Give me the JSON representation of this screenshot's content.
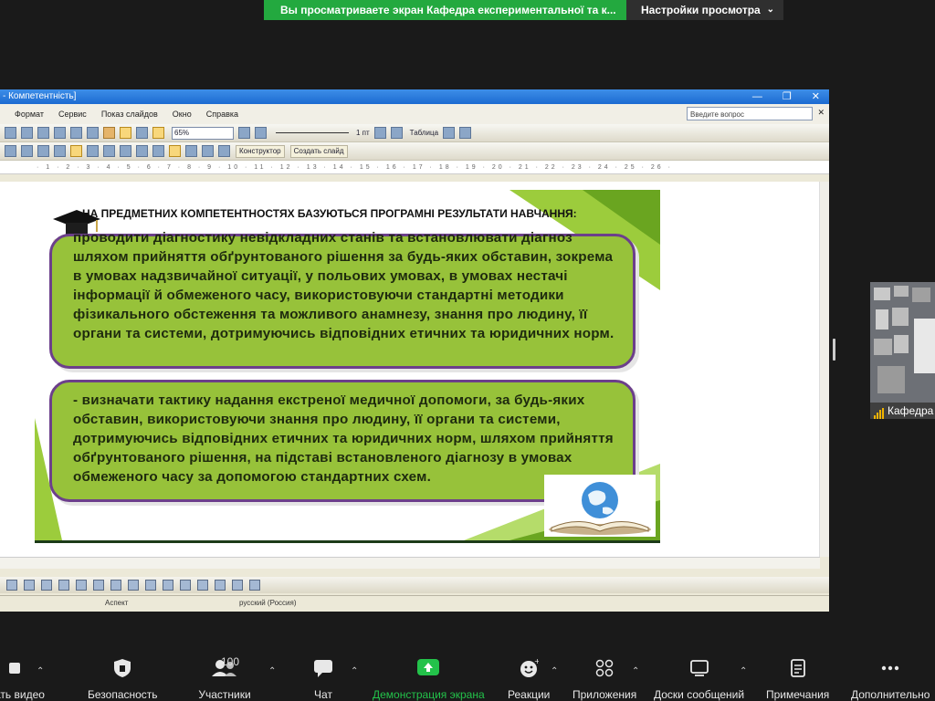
{
  "banner": {
    "viewing_text": "Вы просматриваете экран Кафедра експериментальної та к...",
    "settings_label": "Настройки просмотра"
  },
  "app": {
    "title": "- Компетентність]",
    "menu": [
      "Формат",
      "Сервис",
      "Показ слайдов",
      "Окно",
      "Справка"
    ],
    "ask_placeholder": "Введите вопрос",
    "zoom": "65%",
    "line_weight": "1 пт",
    "table_label": "Таблица",
    "constructor_label": "Конструктор",
    "create_slide_label": "Создать слайд",
    "status_design": "Аспект",
    "status_language": "русский (Россия)"
  },
  "slide": {
    "heading": "НА ПРЕДМЕТНИХ КОМПЕТЕНТНОСТЯХ БАЗУЮТЬСЯ ПРОГРАМНІ РЕЗУЛЬТАТИ НАВЧАННЯ:",
    "box1_text": "проводити діагностику невідкладних станів та встановлювати діагноз шляхом прийняття обґрунтованого рішення за будь-яких обставин, зокрема в умовах надзвичайної ситуації, у польових умовах, в умовах нестачі інформації й обмеженого часу, використовуючи стандартні методики фізикального обстеження та можливого анамнезу, знання про людину, її органи та системи, дотримуючись відповідних етичних та юридичних норм.",
    "box2_text": "- визначати тактику надання екстреної медичної допомоги, за будь-яких обставин, використовуючи знання про людину, її органи та системи, дотримуючись відповідних етичних та юридичних норм, шляхом прийняття обґрунтованого рішення, на підставі встановленого діагнозу в умовах обмеженого часу за допомогою стандартних схем."
  },
  "participant": {
    "name": "Кафедра експ"
  },
  "toolbar": {
    "video_label": "ать видео",
    "security_label": "Безопасность",
    "participants_label": "Участники",
    "participants_count": "100",
    "chat_label": "Чат",
    "share_label": "Демонстрация экрана",
    "reactions_label": "Реакции",
    "apps_label": "Приложения",
    "whiteboards_label": "Доски сообщений",
    "notes_label": "Примечания",
    "more_label": "Дополнительно"
  },
  "colors": {
    "share_green": "#23a93f",
    "box_fill": "#97c23a",
    "box_border": "#6c3f8b",
    "title_blue": "#1c6bd1"
  }
}
